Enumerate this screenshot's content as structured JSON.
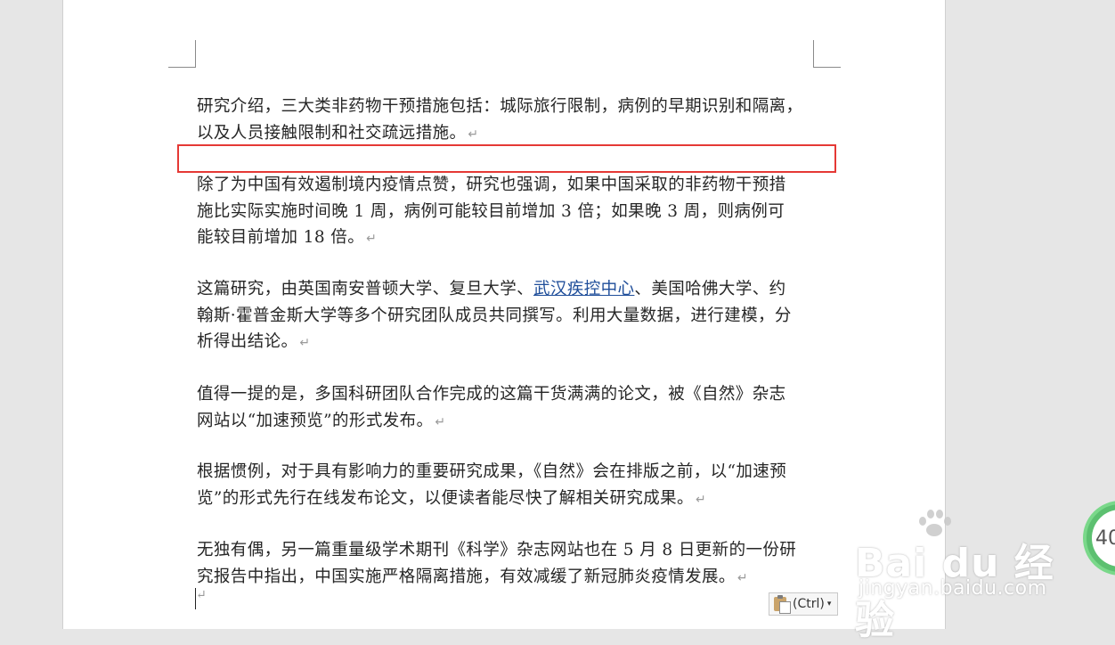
{
  "document": {
    "paragraphs": [
      {
        "lines": [
          "研究介绍，三大类非药物干预措施包括：城际旅行限制，病例的早期识别和隔离，",
          "以及人员接触限制和社交疏远措施。"
        ]
      },
      {
        "lines": [
          "除了为中国有效遏制境内疫情点赞，研究也强调，如果中国采取的非药物干预措",
          "施比实际实施时间晚 1 周，病例可能较目前增加 3 倍；如果晚 3 周，则病例可",
          "能较目前增加 18 倍。"
        ]
      },
      {
        "line1_pre": "这篇研究，由英国南安普顿大学、复旦大学、",
        "line1_link": "武汉疾控中心",
        "line1_post": "、美国哈佛大学、约",
        "lines_rest": [
          "翰斯·霍普金斯大学等多个研究团队成员共同撰写。利用大量数据，进行建模，分",
          "析得出结论。"
        ]
      },
      {
        "lines": [
          "值得一提的是，多国科研团队合作完成的这篇干货满满的论文，被《自然》杂志",
          "网站以“加速预览”的形式发布。"
        ]
      },
      {
        "lines": [
          "根据惯例，对于具有影响力的重要研究成果，《自然》会在排版之前，以“加速预",
          "览”的形式先行在线发布论文，以便读者能尽快了解相关研究成果。"
        ]
      },
      {
        "lines": [
          "无独有偶，另一篇重量级学术期刊《科学》杂志网站也在 5 月 8 日更新的一份研",
          "究报告中指出，中国实施严格隔离措施，有效减缓了新冠肺炎疫情发展。"
        ]
      }
    ],
    "paragraph_mark": "↵"
  },
  "paste_options": {
    "label": "(Ctrl)",
    "caret": "▾"
  },
  "watermark": {
    "brand": "Bai du 经验",
    "url": "jingyan.baidu.com"
  },
  "badge": {
    "text": "40"
  },
  "colors": {
    "highlight_border": "#e53935",
    "link": "#1f4e9a"
  }
}
